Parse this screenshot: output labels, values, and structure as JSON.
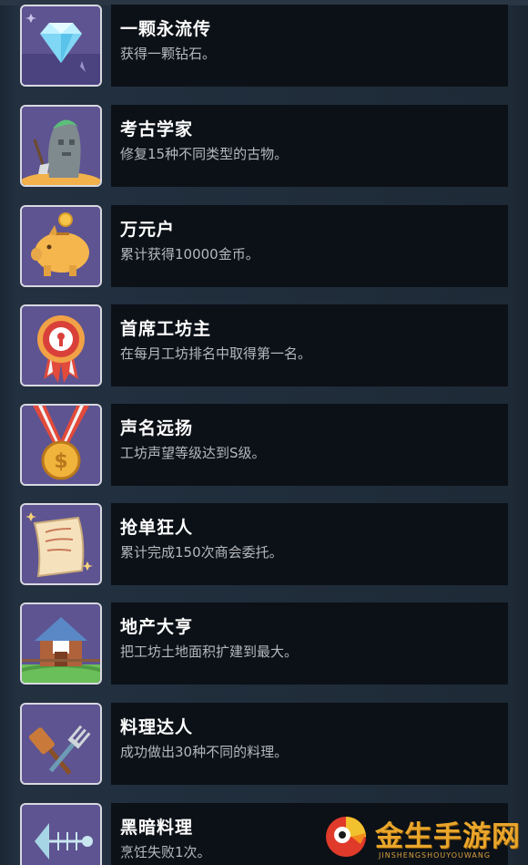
{
  "achievements": [
    {
      "title": "一颗永流传",
      "desc": "获得一颗钻石。",
      "icon": "diamond-icon"
    },
    {
      "title": "考古学家",
      "desc": "修复15种不同类型的古物。",
      "icon": "stone-statue-icon"
    },
    {
      "title": "万元户",
      "desc": "累计获得10000金币。",
      "icon": "piggy-bank-icon"
    },
    {
      "title": "首席工坊主",
      "desc": "在每月工坊排名中取得第一名。",
      "icon": "rosette-badge-icon"
    },
    {
      "title": "声名远扬",
      "desc": "工坊声望等级达到S级。",
      "icon": "medal-icon"
    },
    {
      "title": "抢单狂人",
      "desc": "累计完成150次商会委托。",
      "icon": "scroll-icon"
    },
    {
      "title": "地产大亨",
      "desc": "把工坊土地面积扩建到最大。",
      "icon": "house-icon"
    },
    {
      "title": "料理达人",
      "desc": "成功做出30种不同的料理。",
      "icon": "spatula-fork-icon"
    },
    {
      "title": "黑暗料理",
      "desc": "烹饪失败1次。",
      "icon": "fish-bone-icon"
    }
  ],
  "watermark": {
    "name": "金生手游网",
    "domain": "JINSHENGSHOUYOUWANG"
  },
  "colors": {
    "page_bg": "#1f2a35",
    "panel_bg": "#0c1117",
    "icon_bg": "#5e5491",
    "title": "#ffffff",
    "desc": "#b3b8bf",
    "watermark": "#e9a62b"
  }
}
